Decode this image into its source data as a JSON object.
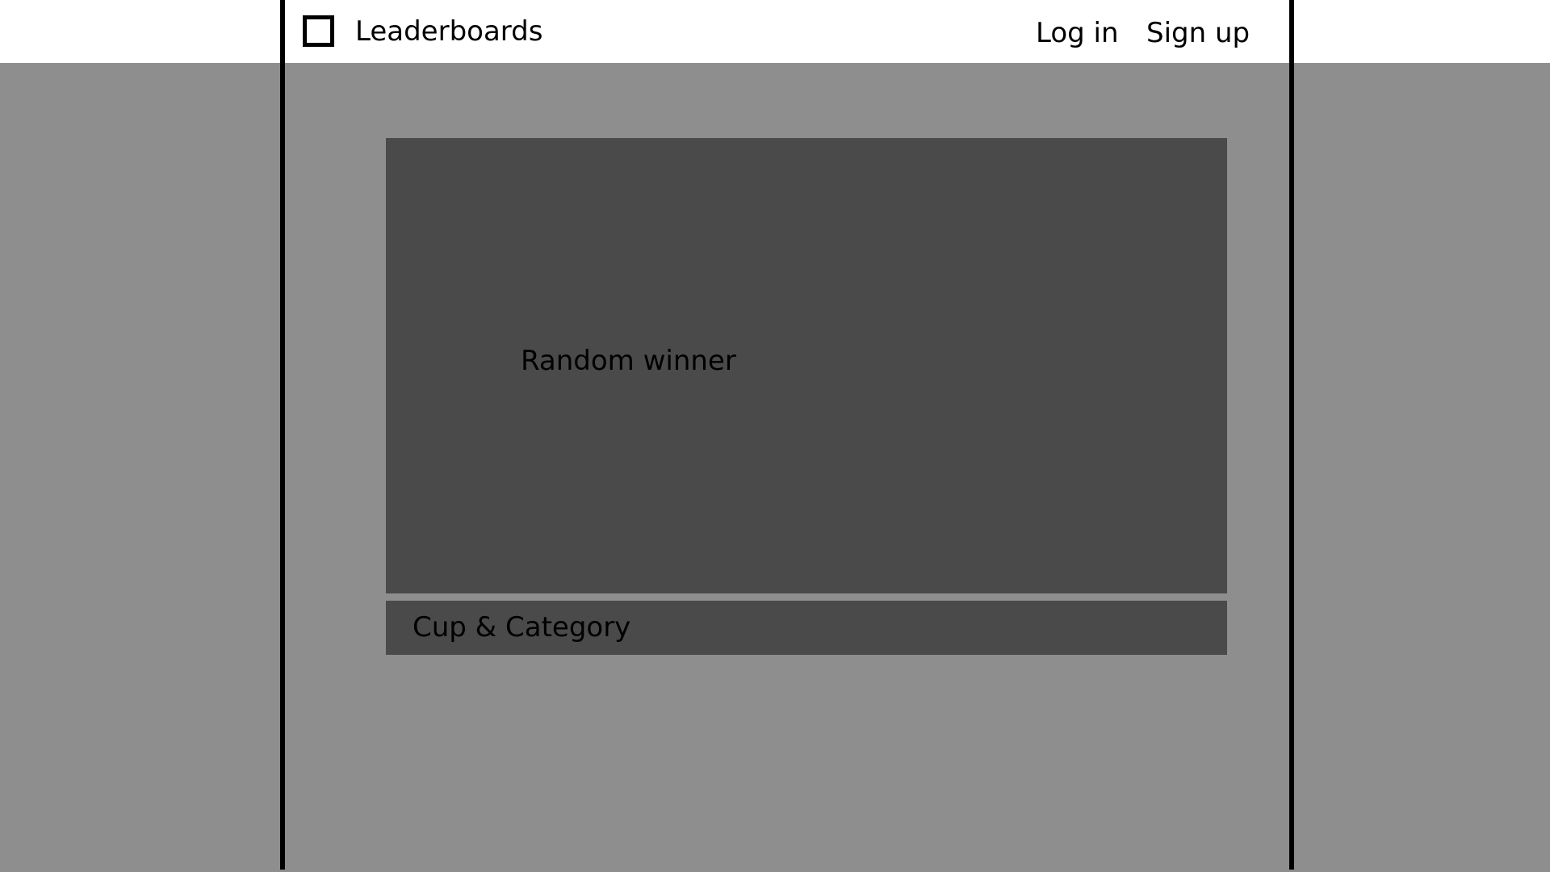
{
  "header": {
    "brand": "Leaderboards",
    "login_label": "Log in",
    "signup_label": "Sign up"
  },
  "main": {
    "hero_text": "Random winner",
    "cup_label": "Cup & Category"
  },
  "icons": {
    "logo": "square-logo-icon"
  },
  "colors": {
    "page_background": "#8e8e8e",
    "header_background": "#ffffff",
    "card_background": "#4a4a4a",
    "frame_lines": "#000000",
    "text": "#000000"
  }
}
